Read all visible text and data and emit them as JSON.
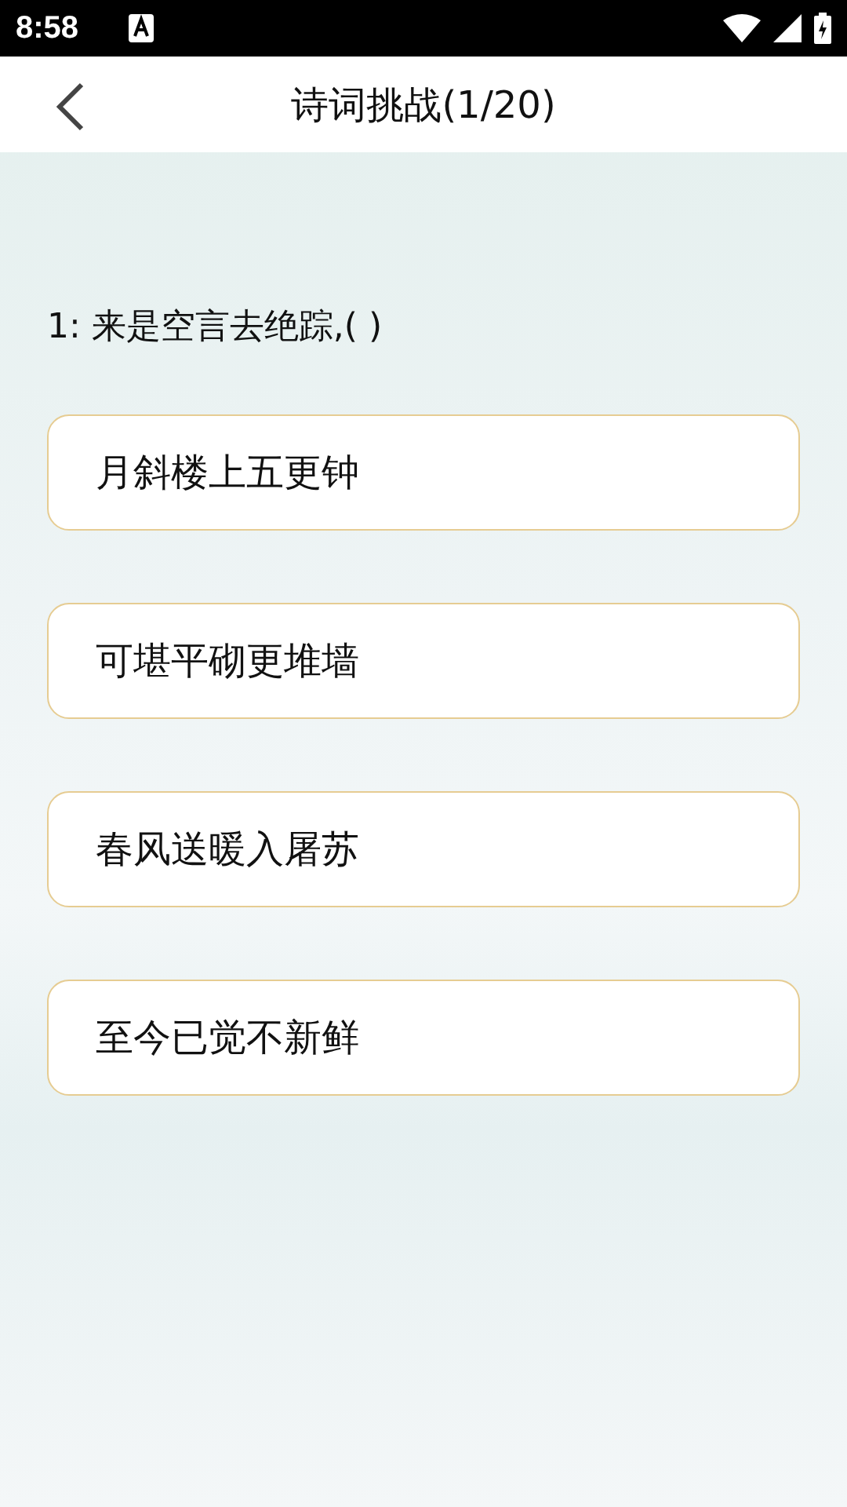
{
  "status_bar": {
    "time": "8:58"
  },
  "header": {
    "title": "诗词挑战(1/20)"
  },
  "question": "1: 来是空言去绝踪,( )",
  "options": [
    {
      "text": "月斜楼上五更钟"
    },
    {
      "text": "可堪平砌更堆墙"
    },
    {
      "text": "春风送暖入屠苏"
    },
    {
      "text": "至今已觉不新鲜"
    }
  ]
}
